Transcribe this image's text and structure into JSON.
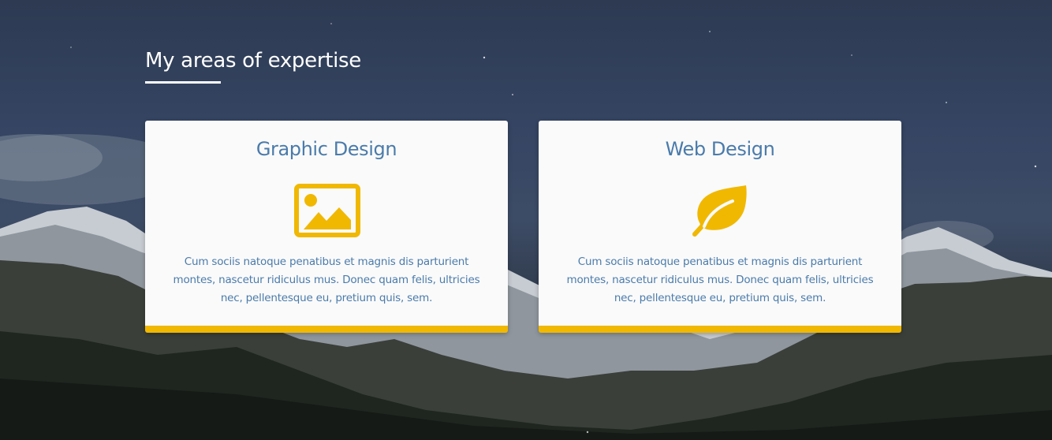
{
  "section": {
    "title": "My areas of expertise"
  },
  "cards": [
    {
      "title": "Graphic Design",
      "icon": "image-icon",
      "text": "Cum sociis natoque penatibus et magnis dis parturient montes, nascetur ridiculus mus. Donec quam felis, ultricies nec, pellentesque eu, pretium quis, sem."
    },
    {
      "title": "Web Design",
      "icon": "leaf-icon",
      "text": "Cum sociis natoque penatibus et magnis dis parturient montes, nascetur ridiculus mus. Donec quam felis, ultricies nec, pellentesque eu, pretium quis, sem."
    }
  ],
  "colors": {
    "accent": "#f0b800",
    "card_text": "#4a7bab",
    "card_background": "#fafafa"
  }
}
